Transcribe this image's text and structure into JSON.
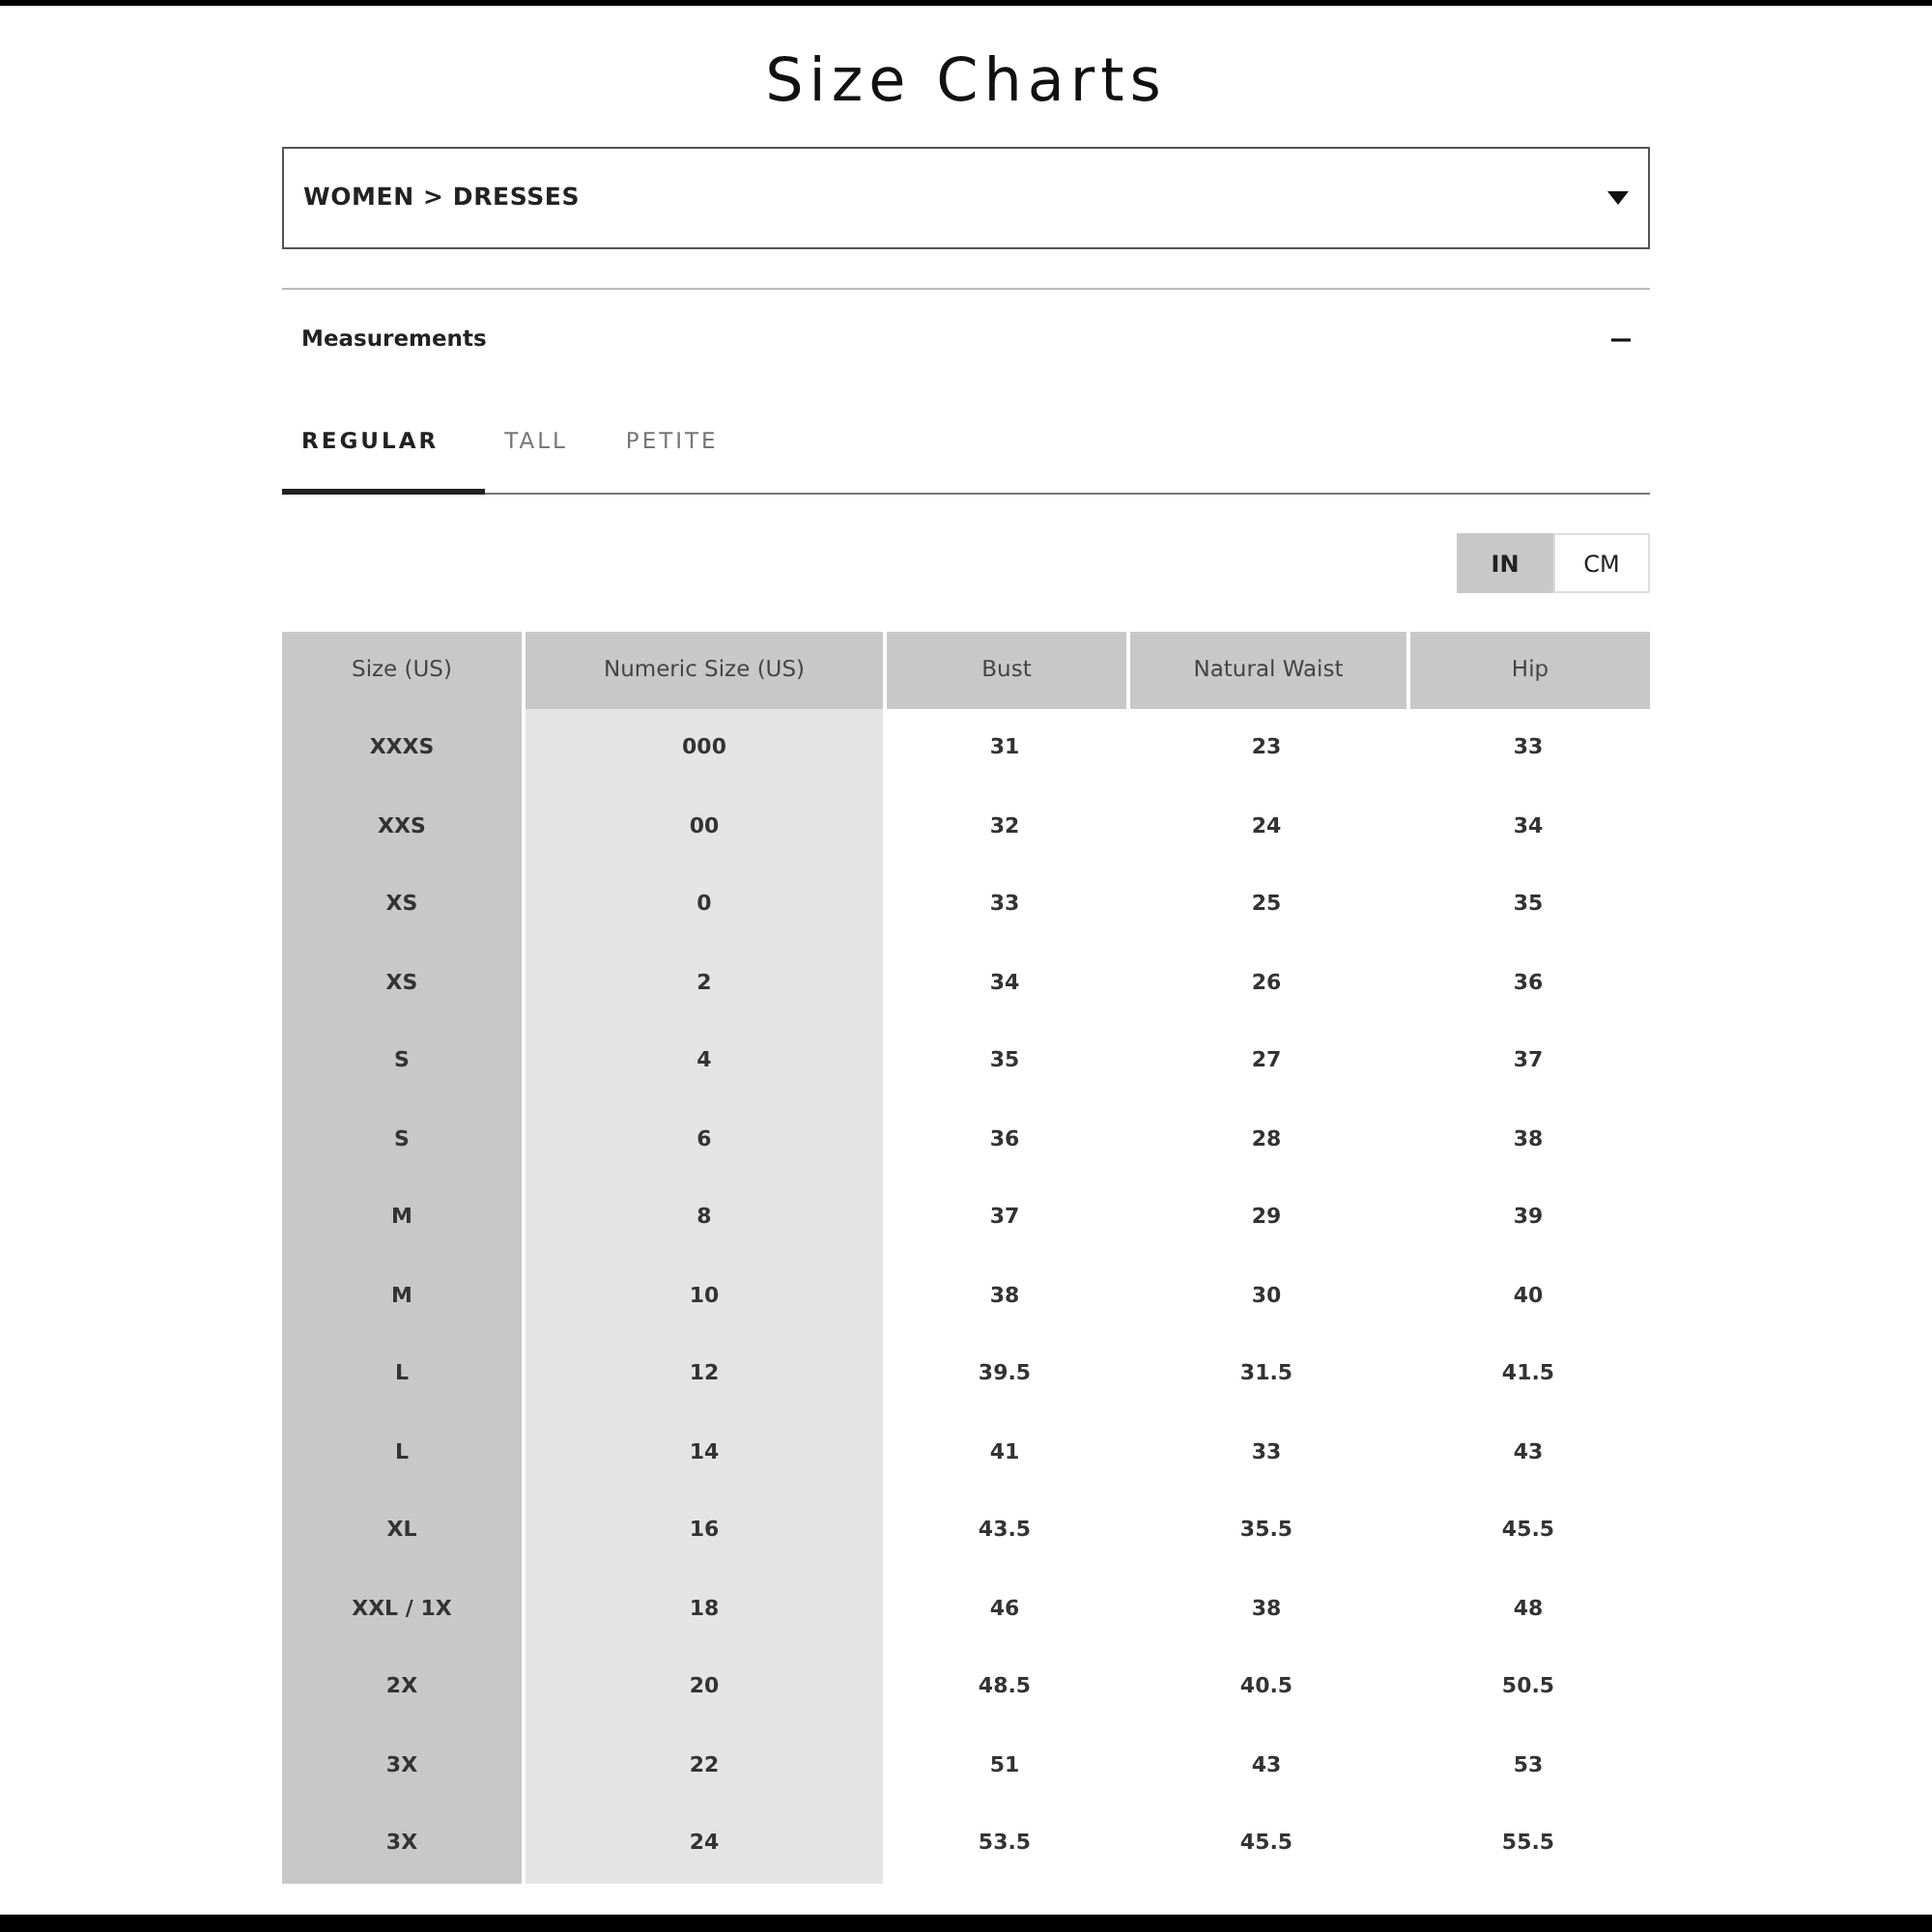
{
  "title": "Size Charts",
  "category_select": {
    "value": "WOMEN > DRESSES"
  },
  "section": {
    "title": "Measurements",
    "expanded": true
  },
  "tabs": [
    {
      "label": "REGULAR",
      "selected": true
    },
    {
      "label": "TALL",
      "selected": false
    },
    {
      "label": "PETITE",
      "selected": false
    }
  ],
  "units": [
    {
      "label": "IN",
      "selected": true
    },
    {
      "label": "CM",
      "selected": false
    }
  ],
  "table": {
    "columns": [
      "Size (US)",
      "Numeric Size (US)",
      "Bust",
      "Natural Waist",
      "Hip"
    ],
    "rows": [
      [
        "XXXS",
        "000",
        "31",
        "23",
        "33"
      ],
      [
        "XXS",
        "00",
        "32",
        "24",
        "34"
      ],
      [
        "XS",
        "0",
        "33",
        "25",
        "35"
      ],
      [
        "XS",
        "2",
        "34",
        "26",
        "36"
      ],
      [
        "S",
        "4",
        "35",
        "27",
        "37"
      ],
      [
        "S",
        "6",
        "36",
        "28",
        "38"
      ],
      [
        "M",
        "8",
        "37",
        "29",
        "39"
      ],
      [
        "M",
        "10",
        "38",
        "30",
        "40"
      ],
      [
        "L",
        "12",
        "39.5",
        "31.5",
        "41.5"
      ],
      [
        "L",
        "14",
        "41",
        "33",
        "43"
      ],
      [
        "XL",
        "16",
        "43.5",
        "35.5",
        "45.5"
      ],
      [
        "XXL / 1X",
        "18",
        "46",
        "38",
        "48"
      ],
      [
        "2X",
        "20",
        "48.5",
        "40.5",
        "50.5"
      ],
      [
        "3X",
        "22",
        "51",
        "43",
        "53"
      ],
      [
        "3X",
        "24",
        "53.5",
        "45.5",
        "55.5"
      ]
    ]
  }
}
